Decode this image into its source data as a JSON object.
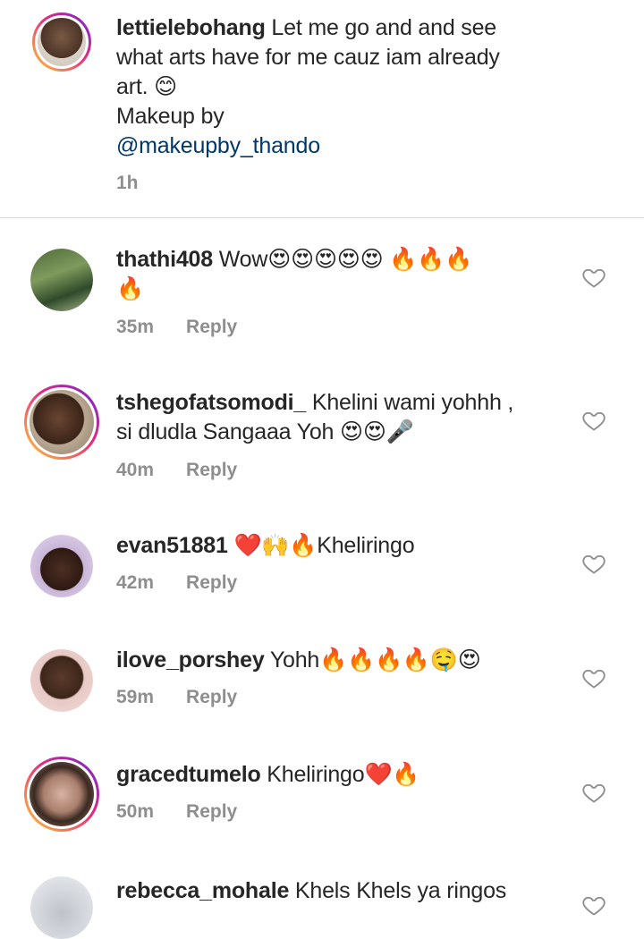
{
  "caption": {
    "username": "lettielebohang",
    "line1": "Let me go and  and see",
    "line2": "what arts have for me cauz iam already",
    "line3": "art. 😊",
    "line4": "Makeup by",
    "mention": "@makeupby_thando",
    "time": "1h"
  },
  "reply_label": "Reply",
  "comments": [
    {
      "username": "thathi408",
      "line1": "Wow😍😍😍😍😍 🔥🔥🔥",
      "line2": "🔥",
      "time": "35m"
    },
    {
      "username": "tshegofatsomodi_",
      "line1": "Khelini wami yohhh ,",
      "line2": "si dludla Sangaaa Yoh 😍😍🎤",
      "time": "40m"
    },
    {
      "username": "evan51881",
      "line1": "❤️🙌🔥Kheliringo",
      "time": "42m"
    },
    {
      "username": "ilove_porshey",
      "line1": "Yohh🔥🔥🔥🔥🤤😍",
      "time": "59m"
    },
    {
      "username": "gracedtumelo",
      "line1": "Kheliringo❤️🔥",
      "time": "50m"
    },
    {
      "username": "rebecca_mohale",
      "line1": "Khels Khels ya ringos"
    }
  ],
  "colors": {
    "text": "#262626",
    "meta": "#8e8e8e",
    "mention": "#00376b",
    "divider": "#dbdbdb"
  }
}
